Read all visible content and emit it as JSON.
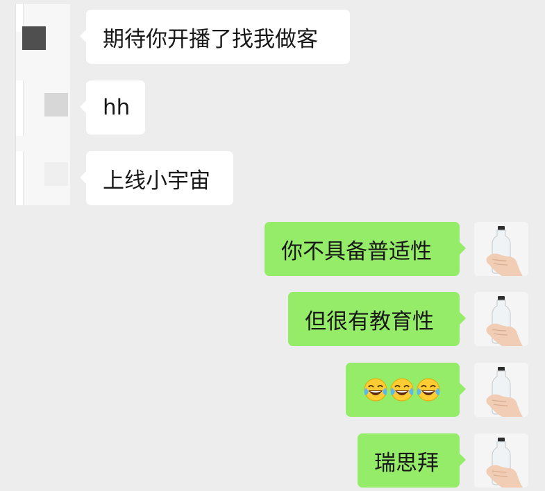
{
  "messages": [
    {
      "sender": "other",
      "text": "期待你开播了找我做客"
    },
    {
      "sender": "other",
      "text": "hh"
    },
    {
      "sender": "other",
      "text": "上线小宇宙"
    },
    {
      "sender": "me",
      "text": "你不具备普适性"
    },
    {
      "sender": "me",
      "text": "但很有教育性"
    },
    {
      "sender": "me",
      "emoji": [
        "😂",
        "😂",
        "😂"
      ]
    },
    {
      "sender": "me",
      "text": "瑞思拜"
    }
  ],
  "colors": {
    "background": "#ededed",
    "incoming_bubble": "#ffffff",
    "outgoing_bubble": "#95ec69",
    "text": "#181818"
  },
  "icons": {
    "other_avatar": "censored-avatar",
    "my_avatar": "hand-holding-bottle-avatar",
    "emoji": "face-with-tears-of-joy"
  }
}
